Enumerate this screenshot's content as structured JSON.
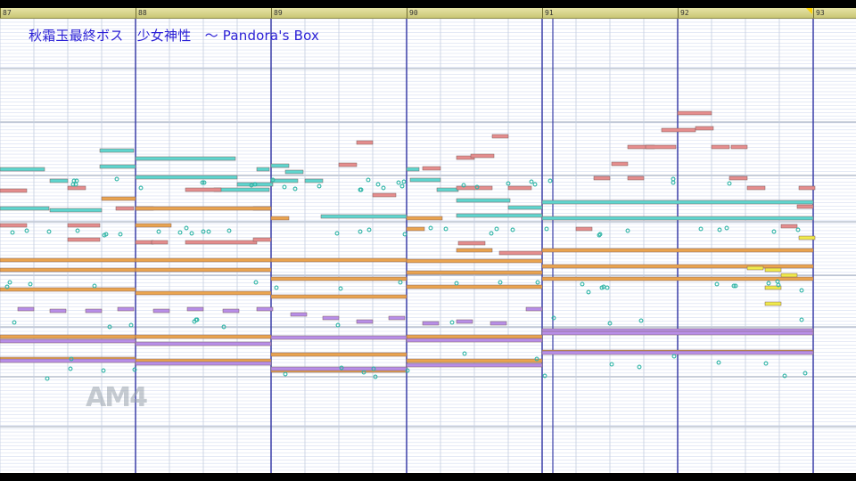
{
  "ruler": {
    "bars": [
      "87",
      "88",
      "89",
      "90",
      "91",
      "92",
      "93"
    ],
    "loop_marker_color": "#ffd400"
  },
  "piano_roll": {
    "title": "秋霜玉最終ボス　少女神性　～ Pandora's Box",
    "background_color": "#ffffff",
    "note_colors": {
      "cyan": "#5fd6cf",
      "red": "#e58d8d",
      "orange": "#eaa44f",
      "purple": "#b88ee8",
      "yellow": "#f0ea4a",
      "teal_dot": "#2fb5a6"
    }
  },
  "watermark": {
    "text": "AM4"
  }
}
